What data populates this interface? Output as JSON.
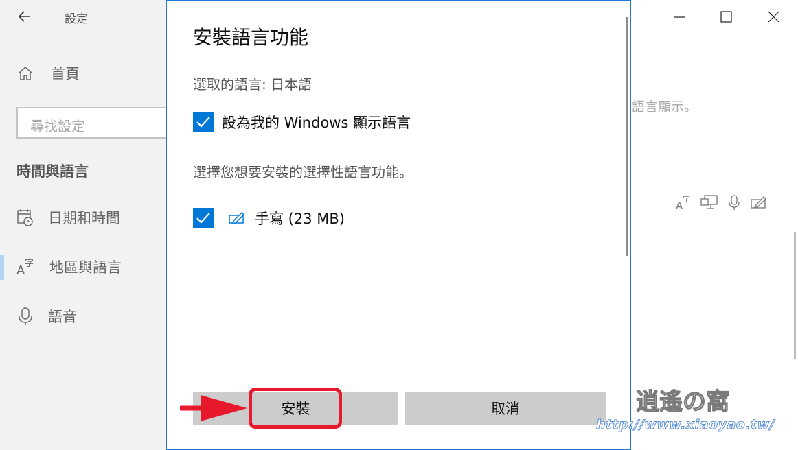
{
  "sidebar": {
    "app_title": "設定",
    "home_label": "首頁",
    "search_placeholder": "尋找設定",
    "section_title": "時間與語言",
    "items": [
      {
        "label": "日期和時間",
        "icon": "calendar-clock-icon"
      },
      {
        "label": "地區與語言",
        "icon": "language-icon",
        "selected": true
      },
      {
        "label": "語音",
        "icon": "microphone-icon"
      }
    ]
  },
  "main": {
    "desc_fragment": "語言顯示。",
    "feature_icons": [
      "language-icon",
      "display-icon",
      "microphone-icon",
      "pen-icon"
    ]
  },
  "dialog": {
    "title": "安裝語言功能",
    "selected_language": "選取的語言: 日本語",
    "display_language_label": "設為我的 Windows 顯示語言",
    "display_language_checked": true,
    "prompt": "選擇您想要安裝的選擇性語言功能。",
    "features": [
      {
        "label": "手寫 (23 MB)",
        "checked": true,
        "icon": "pen-icon"
      }
    ],
    "install_label": "安裝",
    "cancel_label": "取消"
  },
  "watermark": {
    "logo": "逍遙の窩",
    "url": "http://www.xiaoyao.tw/"
  },
  "colors": {
    "accent": "#0078d7",
    "highlight": "#e8192c",
    "button": "#cccccc"
  }
}
